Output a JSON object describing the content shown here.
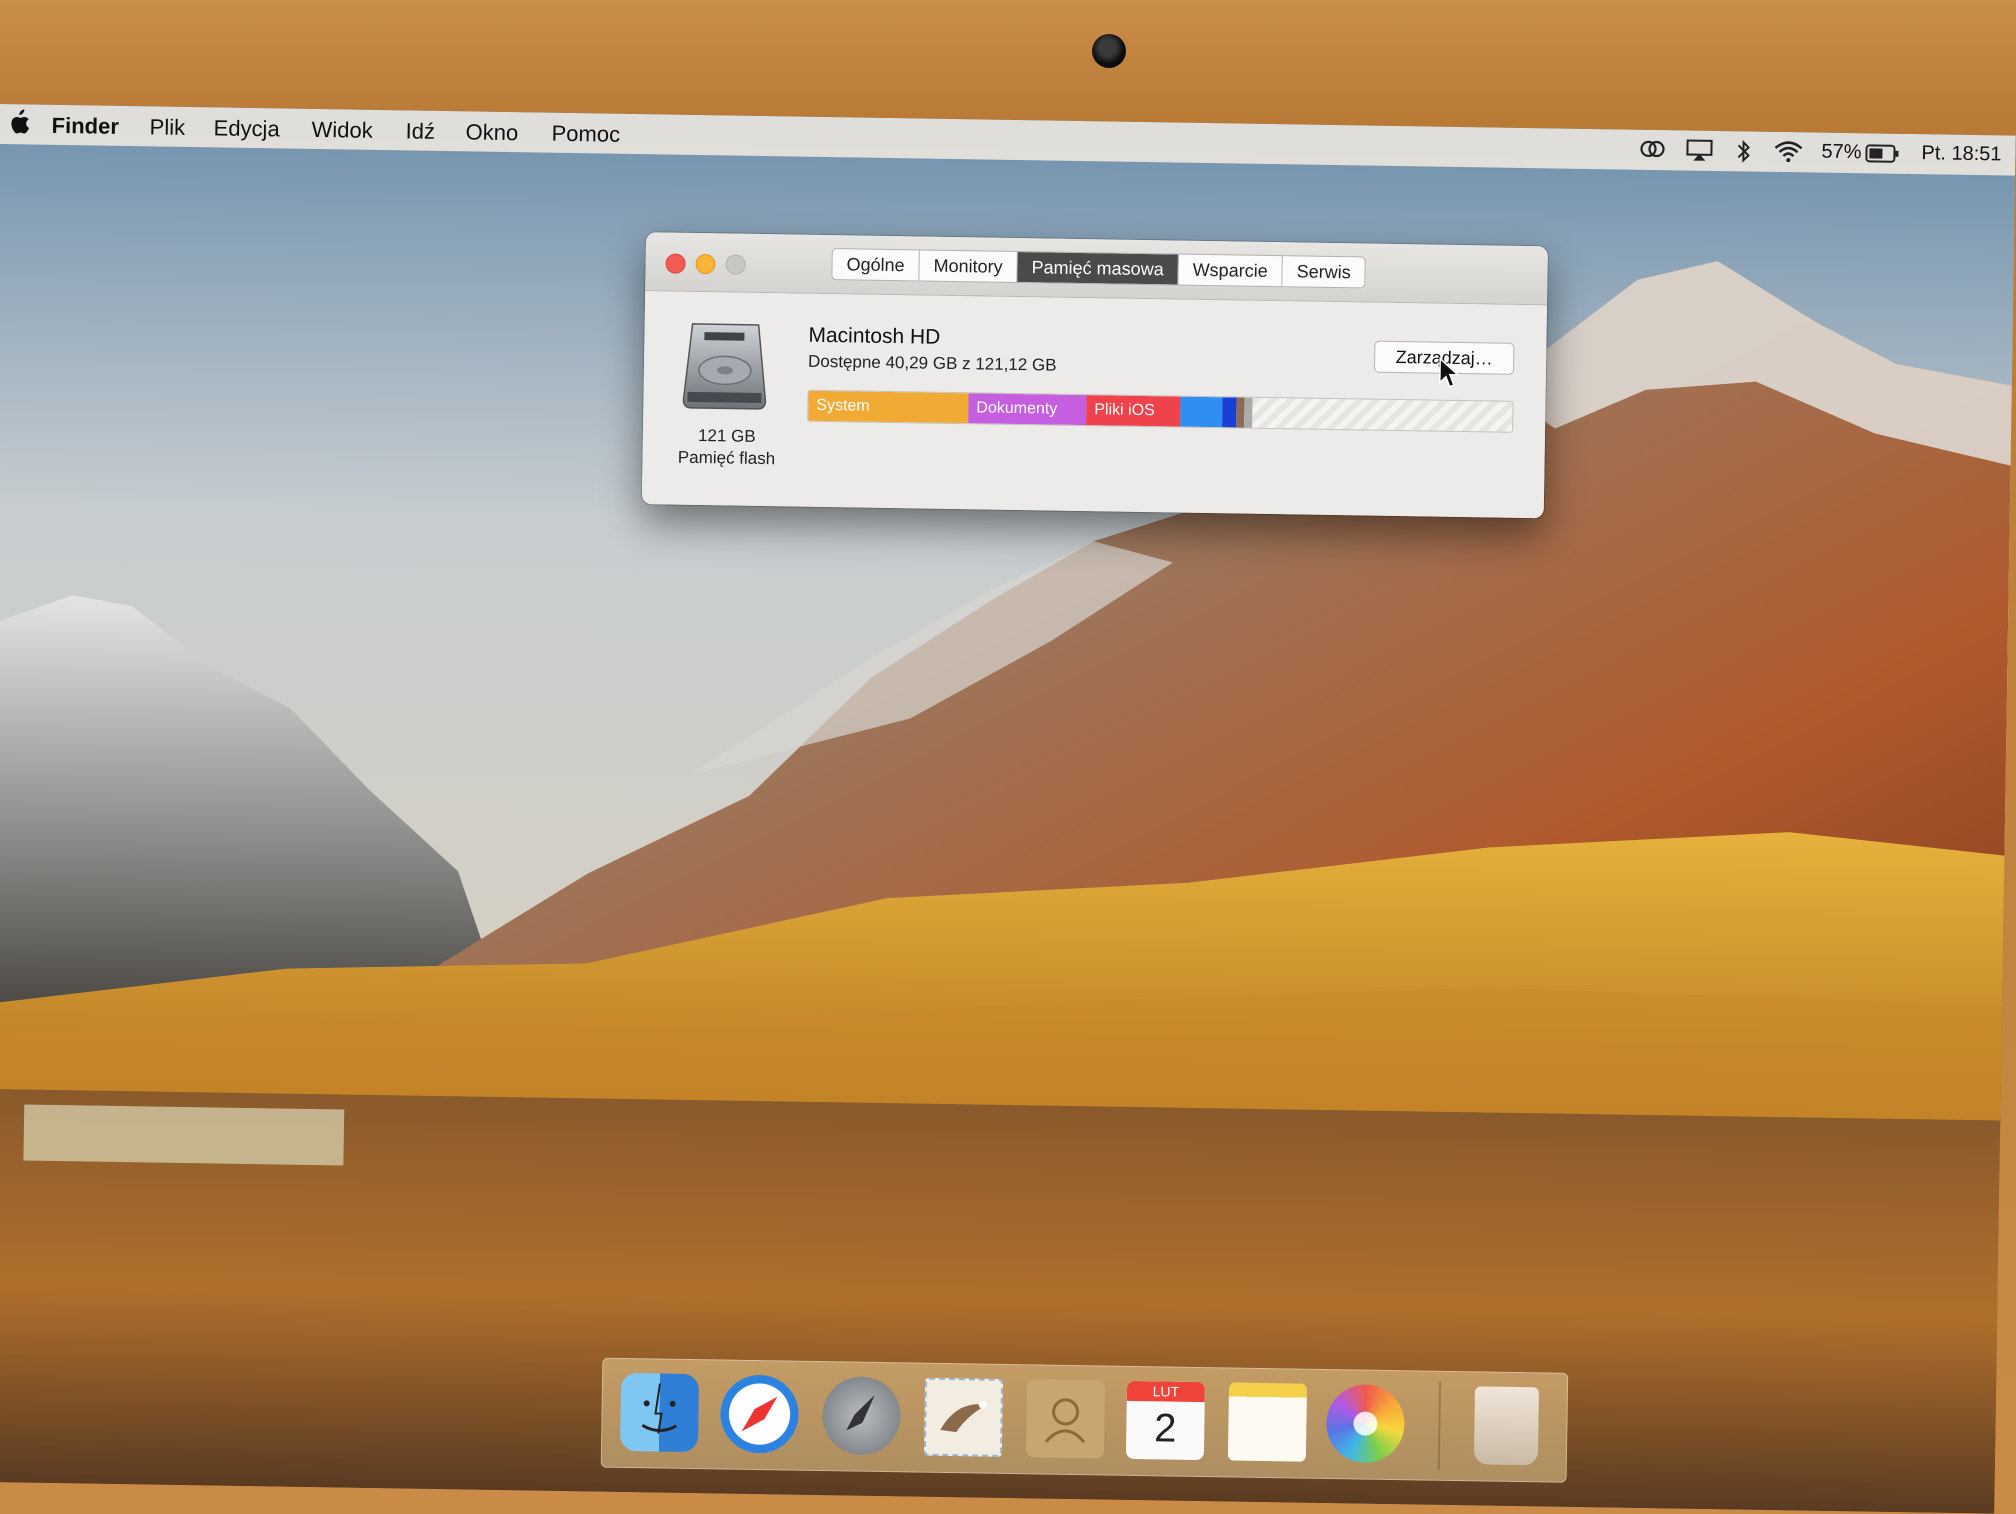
{
  "menubar": {
    "apple_icon": "apple-icon",
    "items": [
      "Finder",
      "Plik",
      "Edycja",
      "Widok",
      "Idź",
      "Okno",
      "Pomoc"
    ],
    "battery_percent": "57%",
    "clock": "Pt. 18:51"
  },
  "window": {
    "tabs": [
      "Ogólne",
      "Monitory",
      "Pamięć masowa",
      "Wsparcie",
      "Serwis"
    ],
    "active_tab": "Pamięć masowa",
    "disk": {
      "capacity": "121 GB",
      "type": "Pamięć flash",
      "name": "Macintosh HD",
      "available": "Dostępne 40,29 GB z 121,12 GB"
    },
    "manage_button": "Zarządzaj…",
    "storage_bar": [
      {
        "label": "System",
        "fraction": 0.227,
        "color": "#f1aa34"
      },
      {
        "label": "Dokumenty",
        "fraction": 0.168,
        "color": "#c55fe0"
      },
      {
        "label": "Pliki iOS",
        "fraction": 0.133,
        "color": "#f0424b"
      },
      {
        "label": "",
        "fraction": 0.06,
        "color": "#2f8ef2"
      },
      {
        "label": "",
        "fraction": 0.02,
        "color": "#1a3fd6"
      },
      {
        "label": "",
        "fraction": 0.012,
        "color": "#8d6a58"
      },
      {
        "label": "",
        "fraction": 0.012,
        "color": "#ababab"
      }
    ]
  },
  "dock": {
    "icons": [
      "finder-icon",
      "safari-icon",
      "launchpad-icon",
      "mail-icon",
      "contacts-icon",
      "calendar-icon",
      "notes-icon",
      "photos-icon",
      "trash-icon"
    ],
    "calendar_month": "LUT",
    "calendar_day": "2"
  }
}
